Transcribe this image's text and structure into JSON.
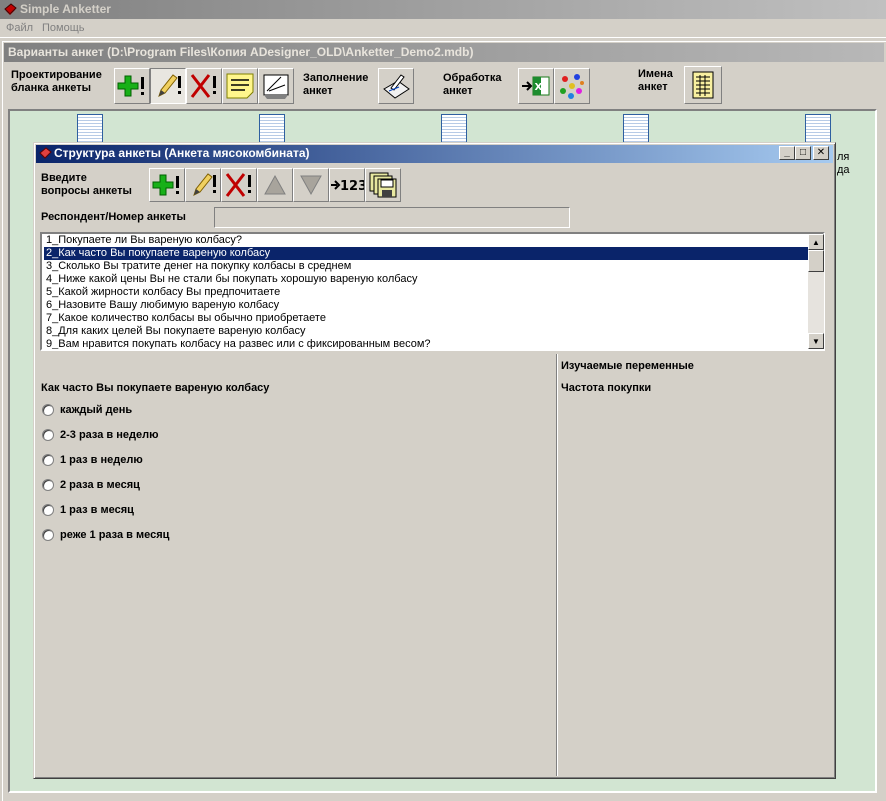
{
  "app": {
    "title": "Simple Anketter"
  },
  "menu": [
    {
      "label": "Файл"
    },
    {
      "label": "Помощь"
    }
  ],
  "child": {
    "title": "Варианты анкет (D:\\Program Files\\Копия ADesigner_OLD\\Anketter_Demo2.mdb)",
    "toolbar": {
      "design_label_1": "Проектирование",
      "design_label_2": "бланка анкеты",
      "fill_label_1": "Заполнение",
      "fill_label_2": "анкет",
      "process_label_1": "Обработка",
      "process_label_2": "анкет",
      "names_label_1": "Имена",
      "names_label_2": "анкет",
      "buttons": [
        {
          "icon": "add-icon"
        },
        {
          "icon": "edit-pencil-icon"
        },
        {
          "icon": "delete-icon"
        },
        {
          "icon": "notes-icon"
        },
        {
          "icon": "form-preview-icon"
        },
        {
          "icon": "fill-form-icon"
        },
        {
          "icon": "excel-icon"
        },
        {
          "icon": "molecule-icon"
        },
        {
          "icon": "names-list-icon"
        }
      ]
    },
    "workspace_fragments": [
      "ля",
      "да"
    ]
  },
  "dialog": {
    "title": "Структура анкеты (Анкета мясокомбината)",
    "caption_buttons": {
      "minimize": "_",
      "maximize": "□",
      "close": "✕"
    },
    "enter_label_1": "Введите",
    "enter_label_2": "вопросы анкеты",
    "number_glyph": "123",
    "respondent_label": "Респондент/Номер анкеты",
    "respondent_value": "",
    "questions": [
      "1_Покупаете ли Вы вареную колбасу?",
      "2_Как часто Вы покупаете вареную колбасу",
      "3_Сколько Вы тратите денег на покупку колбасы в среднем",
      "4_Ниже какой цены Вы не стали бы покупать хорошую вареную колбасу",
      "5_Какой жирности колбасу Вы предпочитаете",
      "6_Назовите Вашу любимую вареную  колбасу",
      "7_Какое количество колбасы вы обычно приобретаете",
      "8_Для каких целей Вы покупаете вареную колбасу",
      "9_Вам нравится покупать колбасу на развес или с фиксированным весом?"
    ],
    "selected_index": 1,
    "question_text": "Как часто Вы покупаете вареную колбасу",
    "options": [
      "каждый день",
      "2-3 раза в неделю",
      "1 раз в неделю",
      "2 раза в месяц",
      "1 раз в месяц",
      "реже 1 раза в месяц"
    ],
    "variables_label": "Изучаемые переменные",
    "variable_value": "Частота покупки"
  },
  "colors": {
    "selection": "#0a246a",
    "workspace": "#d2e5d2",
    "active_title": "#0a246a"
  }
}
